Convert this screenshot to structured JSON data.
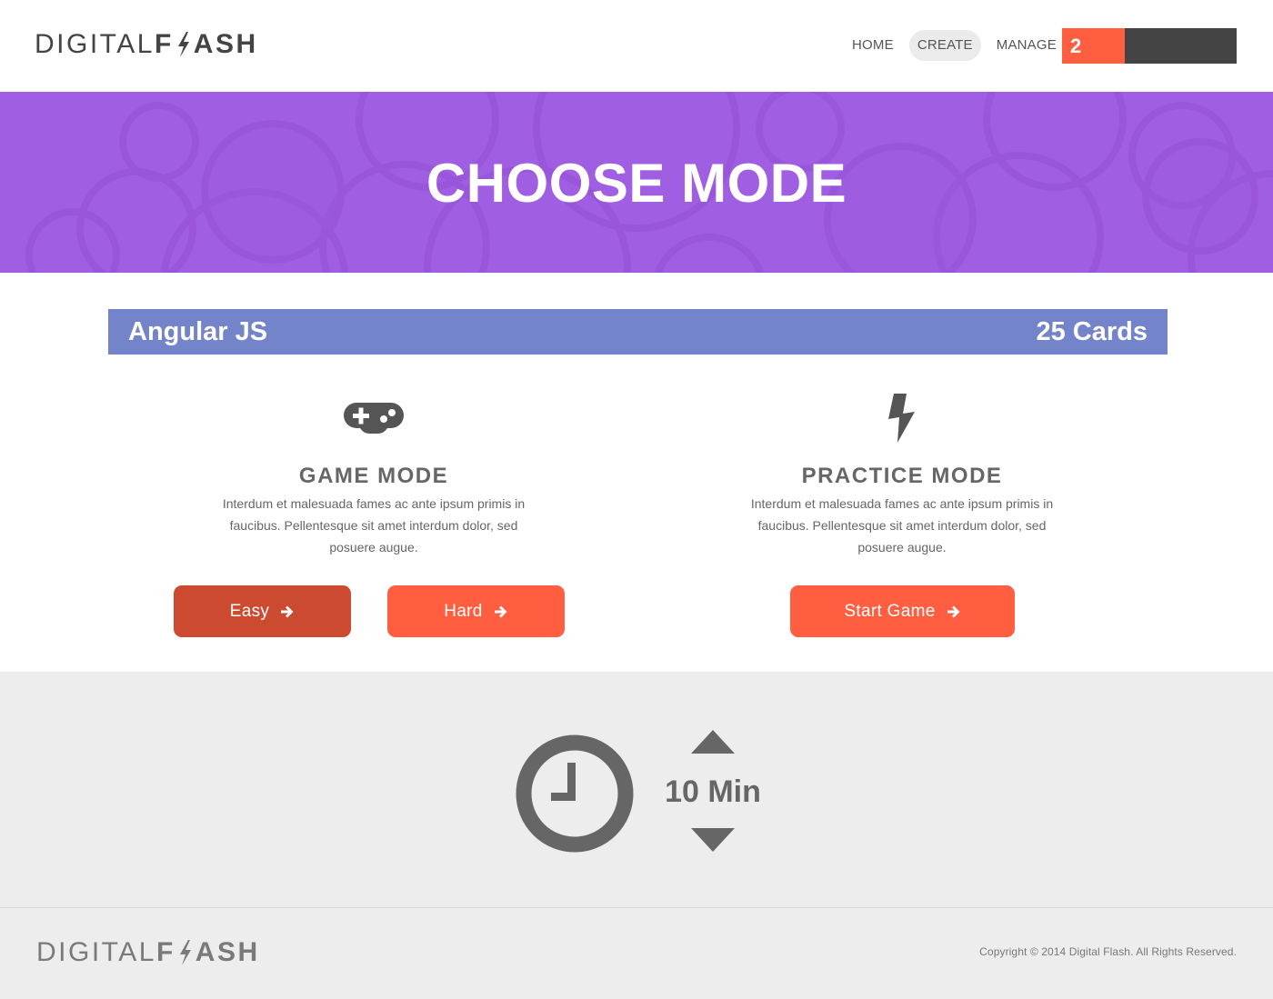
{
  "header": {
    "logo_light": "DIGITAL",
    "logo_bold_f": "F",
    "logo_bold_rest": "ASH",
    "nav": [
      {
        "label": "HOME",
        "active": false
      },
      {
        "label": "CREATE",
        "active": true
      },
      {
        "label": "MANAGE",
        "active": false
      }
    ],
    "counter": "2"
  },
  "banner": {
    "title": "CHOOSE MODE"
  },
  "deck": {
    "name": "Angular JS",
    "count": "25 Cards"
  },
  "modes": {
    "game": {
      "icon": "gamepad-icon",
      "title": "GAME MODE",
      "description": "Interdum et malesuada fames ac ante ipsum primis in faucibus. Pellentesque sit amet interdum dolor, sed posuere augue.",
      "easy_label": "Easy",
      "hard_label": "Hard"
    },
    "practice": {
      "icon": "lightning-icon",
      "title": "PRACTICE MODE",
      "description": "Interdum et malesuada fames ac ante ipsum primis in faucibus. Pellentesque sit amet interdum dolor, sed posuere augue.",
      "start_label": "Start Game"
    }
  },
  "timer": {
    "icon": "clock-icon",
    "value": "10 Min"
  },
  "footer": {
    "logo_light": "DIGITAL",
    "logo_bold_f": "F",
    "logo_bold_rest": "ASH",
    "copyright": "Copyright ©  2014 Digital Flash.  All Rights Reserved."
  },
  "colors": {
    "accent": "#ff5f40",
    "accent_dark": "#cc4a30",
    "banner": "#a05fe3",
    "deck_bar": "#7484cb",
    "dark": "#444444",
    "panel": "#ededed"
  }
}
